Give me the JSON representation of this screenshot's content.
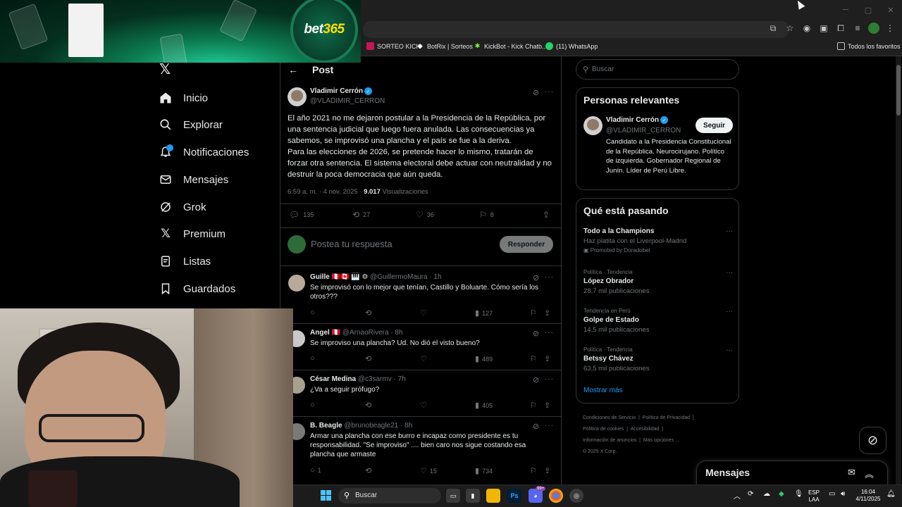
{
  "browser": {
    "bookmarks": [
      {
        "label": "SORTEO KICK",
        "icon": "kick-icon"
      },
      {
        "label": "BotRix | Sorteos",
        "icon": "botrix-icon"
      },
      {
        "label": "KickBot - Kick Chatb...",
        "icon": "kickbot-icon"
      },
      {
        "label": "(11) WhatsApp",
        "icon": "whatsapp-icon"
      }
    ],
    "favorites_label": "Todos los favoritos"
  },
  "banner": {
    "logo_main": "bet",
    "logo_accent": "365"
  },
  "nav": {
    "items": [
      {
        "label": "Inicio",
        "icon": "home-icon"
      },
      {
        "label": "Explorar",
        "icon": "search-icon"
      },
      {
        "label": "Notificaciones",
        "icon": "bell-icon"
      },
      {
        "label": "Mensajes",
        "icon": "mail-icon"
      },
      {
        "label": "Grok",
        "icon": "grok-icon"
      },
      {
        "label": "Premium",
        "icon": "x-icon"
      },
      {
        "label": "Listas",
        "icon": "list-icon"
      },
      {
        "label": "Guardados",
        "icon": "bookmark-icon"
      }
    ]
  },
  "post": {
    "header_title": "Post",
    "author_name": "Vladimir Cerrón",
    "author_handle": "@VLADIMIR_CERRON",
    "text_1": "El año 2021 no me dejaron postular a la Presidencia de la República, por una sentencia judicial que luego fuera anulada. Las consecuencias ya sabemos, se improvisó una plancha y el país se fue a la deriva.",
    "text_2": "Para las elecciones de 2026, se pretende hacer lo mismo, tratarán de forzar otra sentencia. El sistema electoral debe actuar con neutralidad y no destruir la poca democracia que aún queda.",
    "time": "6:59 a. m. · 4 nov. 2025 · ",
    "views_count": "9.017",
    "views_label": " Visualizaciones",
    "replies": "135",
    "reposts": "27",
    "likes": "36",
    "bookmarks": "8",
    "reply_placeholder": "Postea tu respuesta",
    "reply_button": "Responder"
  },
  "replies": [
    {
      "name": "Guille 🇵🇪🇨🇦 🎹 ⚙",
      "handle": "@GuillermoMaura · 1h",
      "text": "Se improvisó con lo mejor que tenían, Castillo y Boluarte. Cómo sería los otros???",
      "replies": "",
      "reposts": "",
      "likes": "",
      "views": "127"
    },
    {
      "name": "Angel 🇵🇪",
      "handle": "@ArnaoRivera · 8h",
      "text": "Se improviso una plancha? Ud. No dió el visto bueno?",
      "replies": "",
      "reposts": "",
      "likes": "",
      "views": "489"
    },
    {
      "name": "César Medina",
      "handle": "@c3sarmv · 7h",
      "text": "¿Va a seguir prófugo?",
      "replies": "",
      "reposts": "",
      "likes": "",
      "views": "405"
    },
    {
      "name": "B. Beagle",
      "handle": "@brunobeagle21 · 8h",
      "text": "Armar una plancha con ese burro e incapaz como presidente es tu responsabilidad. \"Se improviso\" .... bien caro nos sigue costando esa plancha que armaste",
      "replies": "1",
      "reposts": "",
      "likes": "15",
      "views": "734"
    }
  ],
  "sidebar": {
    "search_placeholder": "Buscar",
    "relevant_title": "Personas relevantes",
    "relevant_name": "Vladimir Cerrón",
    "relevant_handle": "@VLADIMIR_CERRON",
    "relevant_bio": "Candidato a la Presidencia Constitucional de la República. Neurocirujano. Político de izquierda. Gobernador Regional de Junín. Líder de Perú Libre.",
    "follow_button": "Seguir",
    "trending_title": "Qué está pasando",
    "trends": [
      {
        "category": "",
        "name": "Todo a la Champions",
        "sub": "Haz platita con el Liverpool-Madrid",
        "promo": "Promoted by Doradobet"
      },
      {
        "category": "Política · Tendencia",
        "name": "López Obrador",
        "sub": "28,7 mil publicaciones",
        "promo": ""
      },
      {
        "category": "Tendencia en Perú",
        "name": "Golpe de Estado",
        "sub": "14,5 mil publicaciones",
        "promo": ""
      },
      {
        "category": "Política · Tendencia",
        "name": "Betssy Chávez",
        "sub": "63,5 mil publicaciones",
        "promo": ""
      }
    ],
    "show_more": "Mostrar más",
    "footer": {
      "terms": "Condiciones de Servicio",
      "privacy": "Política de Privacidad",
      "cookies": "Política de cookies",
      "accessibility": "Accesibilidad",
      "ads": "Información de anuncios",
      "more": "Más opciones ...",
      "copyright": "© 2025 X Corp."
    },
    "messages_label": "Mensajes"
  },
  "taskbar": {
    "search_placeholder": "Buscar",
    "lang_1": "ESP",
    "lang_2": "LAA",
    "time": "16:04",
    "date": "4/11/2025",
    "discord_badge": "99+"
  },
  "colors": {
    "accent": "#1d9bf0",
    "background": "#000000",
    "bet365_green": "#0c7a4f"
  }
}
